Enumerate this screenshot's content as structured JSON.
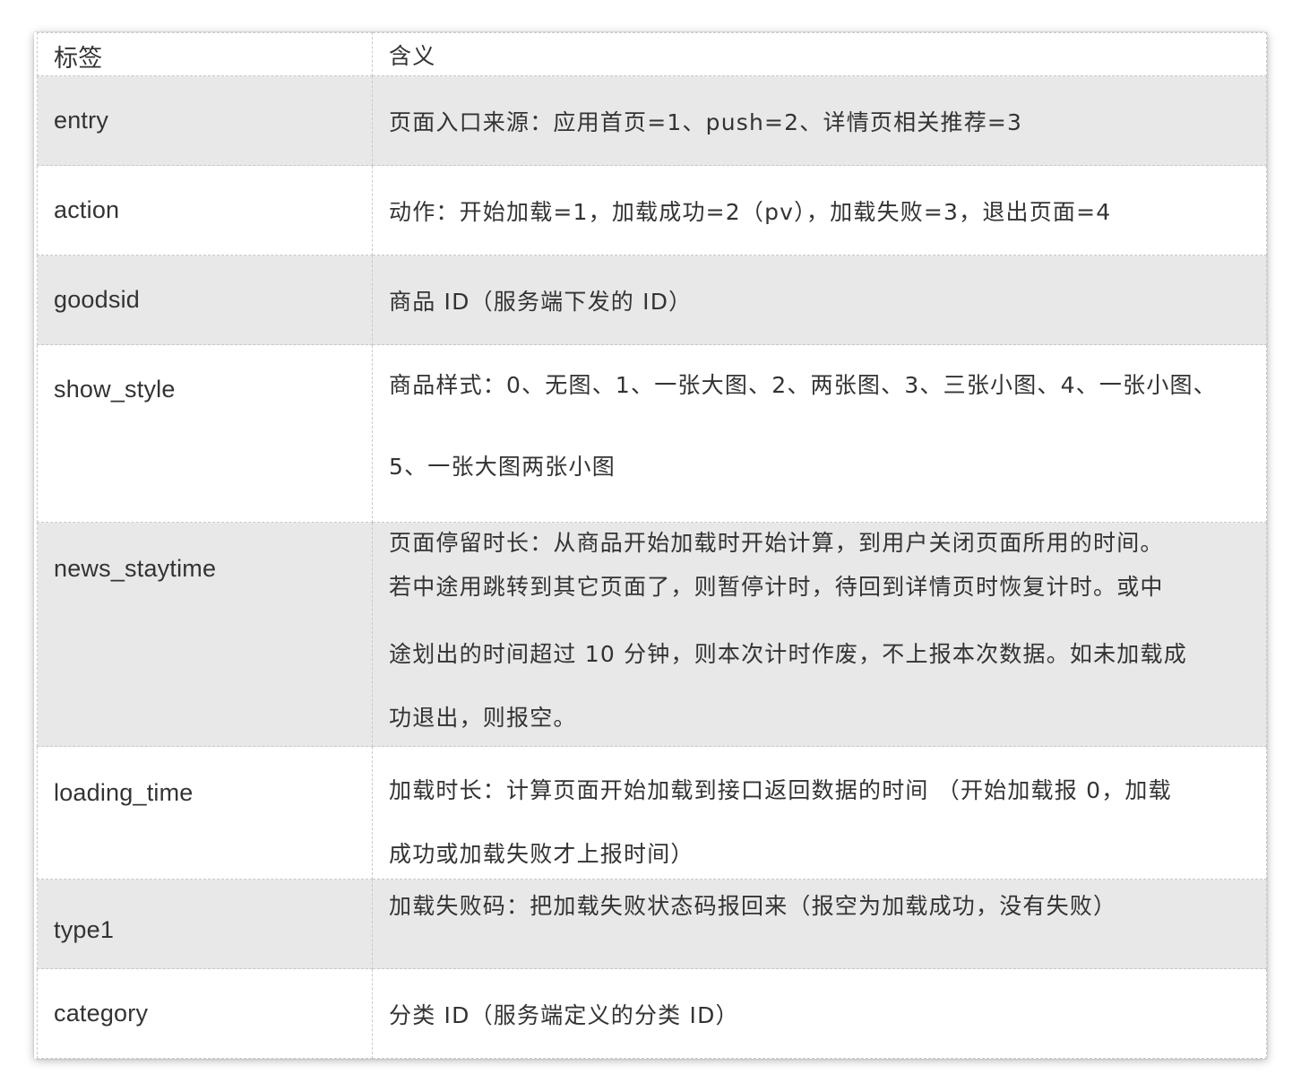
{
  "table": {
    "headers": {
      "label": "标签",
      "meaning": "含义"
    },
    "rows": [
      {
        "label": "entry",
        "meaning": [
          "页面入口来源：应用首页=1、push=2、详情页相关推荐=3"
        ]
      },
      {
        "label": "action",
        "meaning": [
          "动作：开始加载=1，加载成功=2（pv），加载失败=3，退出页面=4"
        ]
      },
      {
        "label": "goodsid",
        "meaning": [
          "商品 ID（服务端下发的 ID）"
        ]
      },
      {
        "label": "show_style",
        "meaning": [
          "商品样式：0、无图、1、一张大图、2、两张图、3、三张小图、4、一张小图、",
          "5、一张大图两张小图"
        ]
      },
      {
        "label": "news_staytime",
        "meaning": [
          "页面停留时长：从商品开始加载时开始计算，到用户关闭页面所用的时间。",
          "若中途用跳转到其它页面了，则暂停计时，待回到详情页时恢复计时。或中",
          "途划出的时间超过 10 分钟，则本次计时作废，不上报本次数据。如未加载成",
          "功退出，则报空。"
        ]
      },
      {
        "label": "loading_time",
        "meaning": [
          "加载时长：计算页面开始加载到接口返回数据的时间 （开始加载报 0，加载",
          "成功或加载失败才上报时间）"
        ]
      },
      {
        "label": "type1",
        "meaning": [
          "加载失败码：把加载失败状态码报回来（报空为加载成功，没有失败）"
        ]
      },
      {
        "label": "category",
        "meaning": [
          "分类 ID（服务端定义的分类 ID）"
        ]
      }
    ]
  }
}
